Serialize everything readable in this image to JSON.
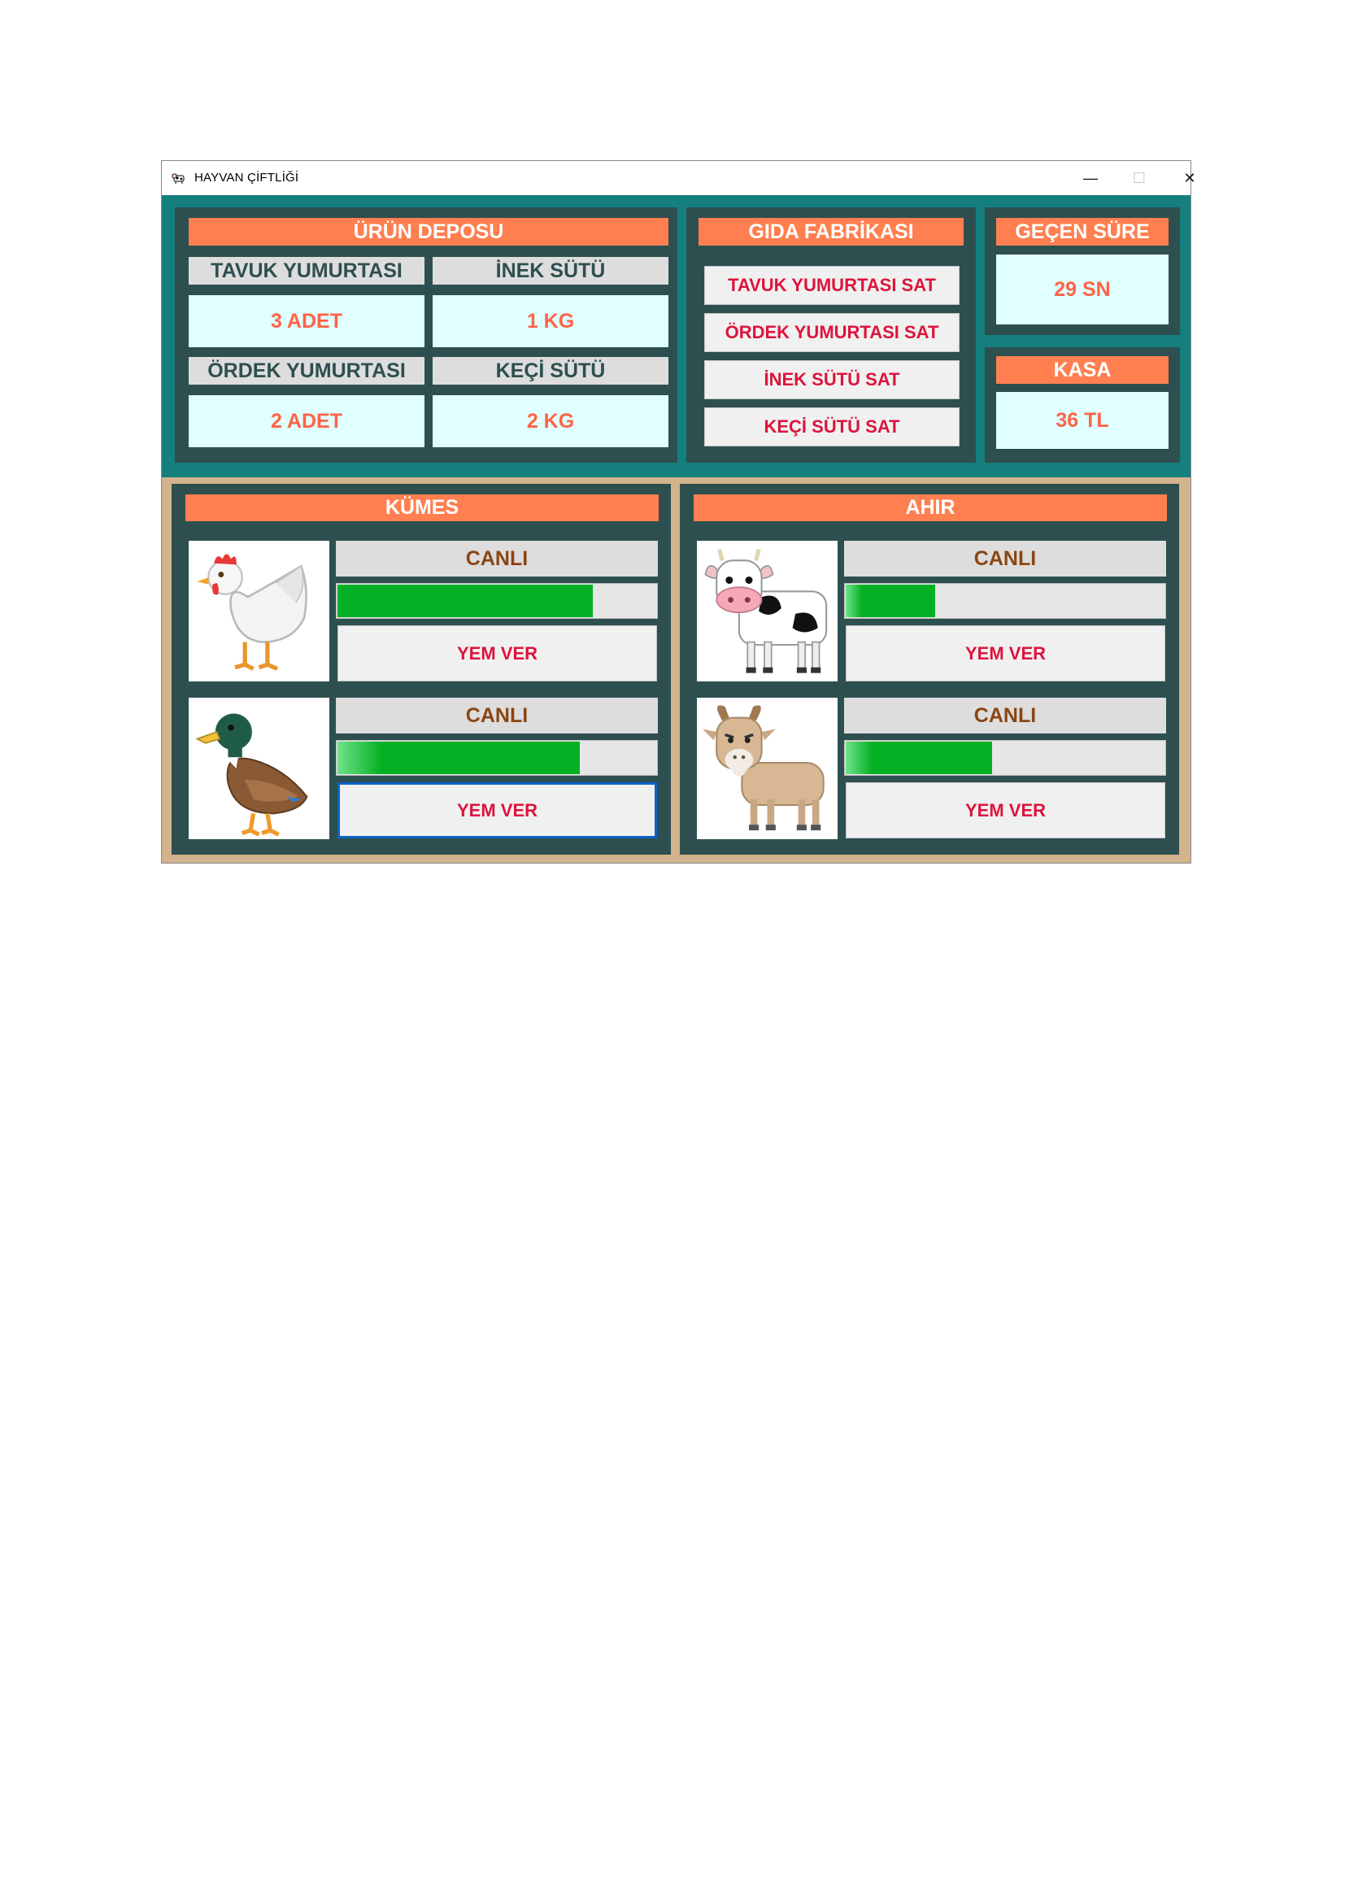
{
  "window": {
    "title": "HAYVAN ÇİFTLİĞİ",
    "controls": {
      "minimize": "—",
      "maximize": "☐",
      "close": "✕"
    }
  },
  "depo": {
    "header": "ÜRÜN DEPOSU",
    "items": [
      {
        "label": "TAVUK YUMURTASI",
        "value": "3 ADET"
      },
      {
        "label": "İNEK SÜTÜ",
        "value": "1 KG"
      },
      {
        "label": "ÖRDEK YUMURTASI",
        "value": "2 ADET"
      },
      {
        "label": "KEÇİ SÜTÜ",
        "value": "2 KG"
      }
    ]
  },
  "fabrika": {
    "header": "GIDA FABRİKASI",
    "buttons": [
      "TAVUK YUMURTASI SAT",
      "ÖRDEK YUMURTASI SAT",
      "İNEK SÜTÜ SAT",
      "KEÇİ SÜTÜ SAT"
    ]
  },
  "sure": {
    "header": "GEÇEN SÜRE",
    "value": "29 SN"
  },
  "kasa": {
    "header": "KASA",
    "value": "36 TL"
  },
  "kumes": {
    "header": "KÜMES",
    "animals": [
      {
        "icon": "chicken-icon",
        "status": "CANLI",
        "health_percent": 80,
        "button": "YEM VER"
      },
      {
        "icon": "duck-icon",
        "status": "CANLI",
        "health_percent": 76,
        "button": "YEM VER"
      }
    ]
  },
  "ahir": {
    "header": "AHIR",
    "animals": [
      {
        "icon": "cow-icon",
        "status": "CANLI",
        "health_percent": 28,
        "button": "YEM VER"
      },
      {
        "icon": "goat-icon",
        "status": "CANLI",
        "health_percent": 46,
        "button": "YEM VER"
      }
    ]
  },
  "colors": {
    "top_background": "#147f7d",
    "bottom_background": "#d2b38c",
    "panel": "#2e4f4f",
    "header": "#ff7f50",
    "value_text": "#ff6347",
    "button_text": "#dc143c",
    "status_text": "#8b4513",
    "progress": "#06b025"
  }
}
